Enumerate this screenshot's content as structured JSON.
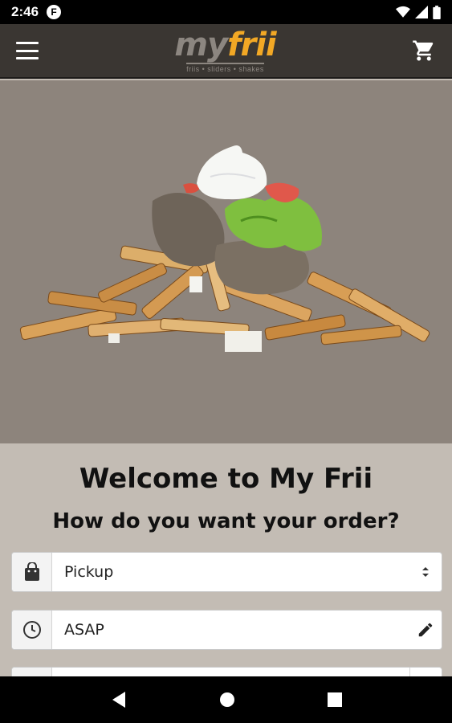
{
  "status_bar": {
    "time": "2:46",
    "notification_badge": "F"
  },
  "app_bar": {
    "logo_my": "my",
    "logo_frii": "frii",
    "logo_tagline": "friis • sliders • shakes"
  },
  "hero": {
    "image": "fries-with-gyro-meat-lettuce-tomato-sour-cream"
  },
  "main": {
    "welcome_title": "Welcome to My Frii",
    "order_question": "How do you want your order?",
    "order_type": {
      "value": "Pickup",
      "icon": "shopping-bag-icon"
    },
    "order_time": {
      "value": "ASAP",
      "icon": "clock-icon"
    }
  },
  "colors": {
    "app_bar": "#3a3632",
    "brand_orange": "#f2a825",
    "hero_bg": "#8d847c",
    "content_bg": "#c3bcb4"
  }
}
